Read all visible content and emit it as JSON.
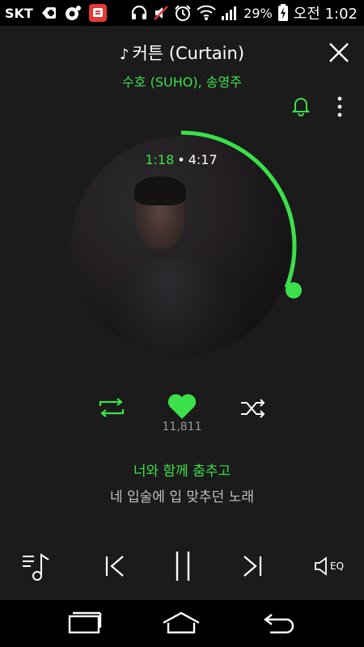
{
  "status_bar": {
    "carrier": "SKT",
    "battery_percent": "29%",
    "time": "오전 1:02"
  },
  "player": {
    "song_title": "커튼 (Curtain)",
    "artist": "수호 (SUHO), 송영주",
    "current_time": "1:18",
    "separator": "•",
    "total_time": "4:17",
    "progress": 0.31,
    "like_count": "11,811",
    "lyric_current": "너와 함께 춤추고",
    "lyric_next": "네 입술에 입 맞추던 노래",
    "eq_label": "EQ"
  },
  "colors": {
    "accent": "#3ce04a",
    "background": "#1b1b1b",
    "bars": "#000000"
  },
  "icons": {
    "close": "close-icon",
    "alarm": "bell-icon",
    "more": "more-vertical-icon",
    "repeat": "repeat-icon",
    "like": "heart-icon",
    "shuffle": "shuffle-icon",
    "playlist": "playlist-icon",
    "previous": "previous-icon",
    "pause": "pause-icon",
    "next": "next-icon",
    "equalizer": "eq-speaker-icon"
  }
}
